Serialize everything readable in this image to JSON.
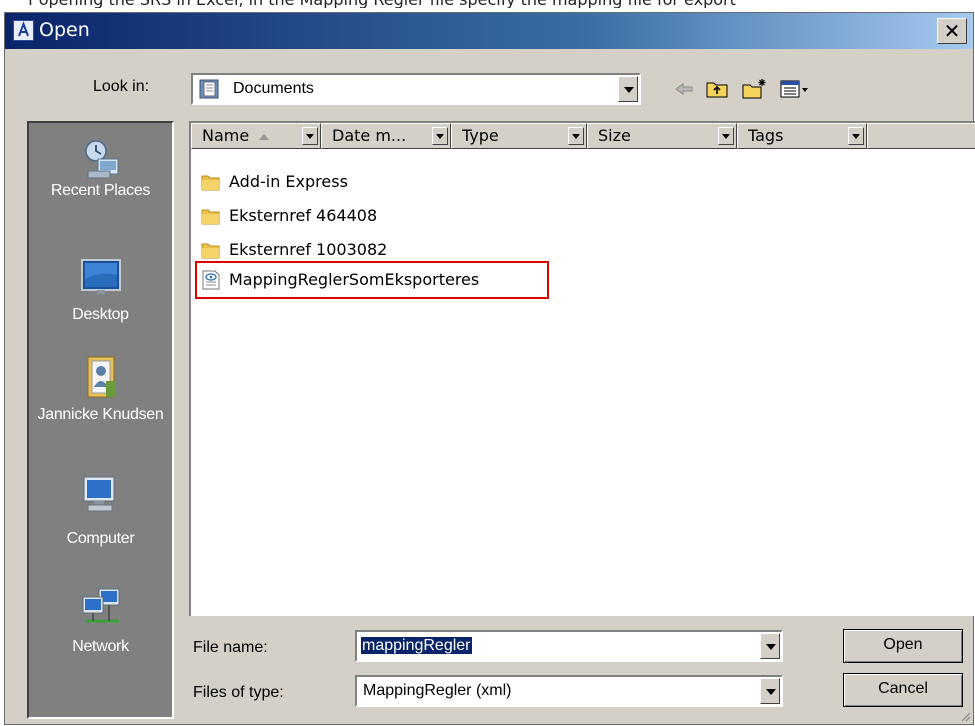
{
  "header_clip_text": "f opening the SRS in Excel, in the Mapping Regler file specify the mapping file for export",
  "window": {
    "title": "Open",
    "close_glyph": "✕"
  },
  "lookin": {
    "label": "Look in:",
    "value": "Documents"
  },
  "toolbar": {
    "back_icon": "back-arrow-icon",
    "up_icon": "up-folder-icon",
    "new_folder_icon": "new-folder-icon",
    "views_icon": "views-menu-icon"
  },
  "places": [
    {
      "label": "Recent Places",
      "icon": "recent-places-icon"
    },
    {
      "label": "Desktop",
      "icon": "desktop-icon"
    },
    {
      "label": "Jannicke Knudsen",
      "icon": "user-folder-icon"
    },
    {
      "label": "Computer",
      "icon": "computer-icon"
    },
    {
      "label": "Network",
      "icon": "network-icon"
    }
  ],
  "columns": [
    {
      "label": "Name"
    },
    {
      "label": "Date m..."
    },
    {
      "label": "Type"
    },
    {
      "label": "Size"
    },
    {
      "label": "Tags"
    }
  ],
  "files": [
    {
      "name": "Add-in Express",
      "kind": "folder"
    },
    {
      "name": "Eksternref 464408",
      "kind": "folder"
    },
    {
      "name": "Eksternref 1003082",
      "kind": "folder"
    },
    {
      "name": "MappingReglerSomEksporteres",
      "kind": "xml-file",
      "highlighted": true
    }
  ],
  "file_name": {
    "label": "File name:",
    "value": "mappingRegler"
  },
  "file_type": {
    "label": "Files of type:",
    "value": "MappingRegler (xml)"
  },
  "buttons": {
    "open": "Open",
    "cancel": "Cancel"
  },
  "colors": {
    "highlight_border": "#e00000",
    "title_gradient_start": "#0a246a",
    "places_bg": "#808080"
  }
}
